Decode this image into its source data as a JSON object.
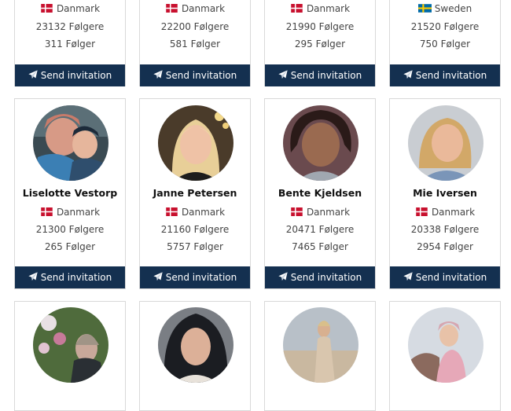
{
  "cards": [
    {
      "name": "",
      "country": "Danmark",
      "flag": "dk",
      "followers": "23132 Følgere",
      "following": "311 Følger",
      "invite": "Send invitation"
    },
    {
      "name": "",
      "country": "Danmark",
      "flag": "dk",
      "followers": "22200 Følgere",
      "following": "581 Følger",
      "invite": "Send invitation"
    },
    {
      "name": "",
      "country": "Danmark",
      "flag": "dk",
      "followers": "21990 Følgere",
      "following": "295 Følger",
      "invite": "Send invitation"
    },
    {
      "name": "",
      "country": "Sweden",
      "flag": "se",
      "followers": "21520 Følgere",
      "following": "750 Følger",
      "invite": "Send invitation"
    },
    {
      "name": "Liselotte Vestorp",
      "country": "Danmark",
      "flag": "dk",
      "followers": "21300 Følgere",
      "following": "265 Følger",
      "invite": "Send invitation"
    },
    {
      "name": "Janne Petersen",
      "country": "Danmark",
      "flag": "dk",
      "followers": "21160 Følgere",
      "following": "5757 Følger",
      "invite": "Send invitation"
    },
    {
      "name": "Bente Kjeldsen",
      "country": "Danmark",
      "flag": "dk",
      "followers": "20471 Følgere",
      "following": "7465 Følger",
      "invite": "Send invitation"
    },
    {
      "name": "Mie Iversen",
      "country": "Danmark",
      "flag": "dk",
      "followers": "20338 Følgere",
      "following": "2954 Følger",
      "invite": "Send invitation"
    }
  ],
  "icons": {
    "invite": "paper-plane-icon",
    "flag_dk": "denmark-flag-icon",
    "flag_se": "sweden-flag-icon"
  },
  "colors": {
    "button": "#143050",
    "flag_dk_red": "#c8102e",
    "flag_se_blue": "#006aa7",
    "flag_se_yellow": "#fecc00"
  }
}
